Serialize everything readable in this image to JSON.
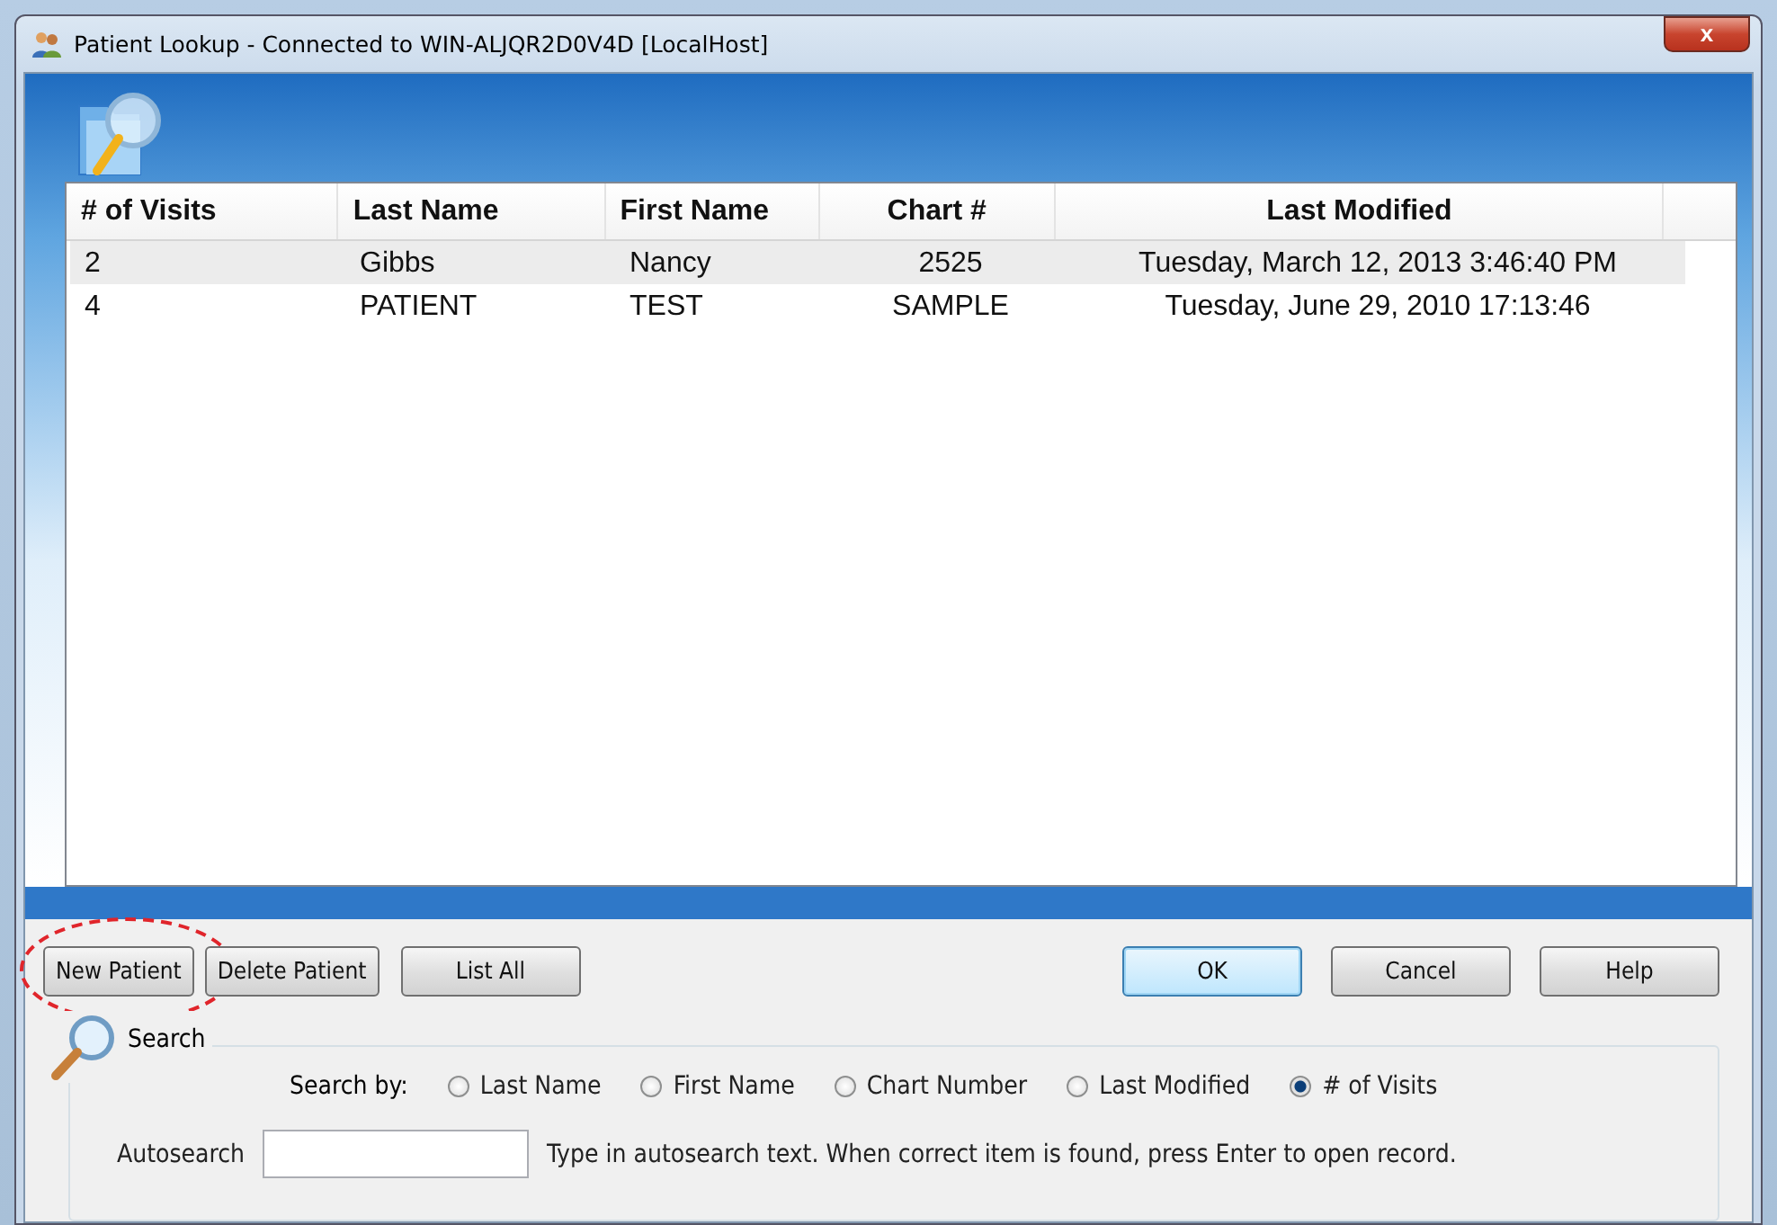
{
  "window": {
    "title": "Patient Lookup - Connected to WIN-ALJQR2D0V4D [LocalHost]",
    "close": "x"
  },
  "table": {
    "columns": [
      "# of Visits",
      "Last Name",
      "First Name",
      "Chart #",
      "Last Modified"
    ],
    "rows": [
      {
        "cells": [
          "2",
          "Gibbs",
          "Nancy",
          "2525",
          "Tuesday, March 12, 2013 3:46:40 PM"
        ],
        "selected": true
      },
      {
        "cells": [
          "4",
          "PATIENT",
          "TEST",
          "SAMPLE",
          "Tuesday, June 29, 2010 17:13:46"
        ],
        "selected": false
      }
    ]
  },
  "buttons_left": [
    {
      "label": "New Patient",
      "highlighted": true
    },
    {
      "label": "Delete Patient",
      "highlighted": false
    },
    {
      "label": "List All",
      "highlighted": false
    }
  ],
  "buttons_right": [
    {
      "label": "OK",
      "default": true
    },
    {
      "label": "Cancel",
      "default": false
    },
    {
      "label": "Help",
      "default": false
    }
  ],
  "search": {
    "title": "Search",
    "search_by_label": "Search by:",
    "options": [
      {
        "label": "Last Name",
        "selected": false
      },
      {
        "label": "First Name",
        "selected": false
      },
      {
        "label": "Chart Number",
        "selected": false
      },
      {
        "label": "Last Modified",
        "selected": false
      },
      {
        "label": "# of Visits",
        "selected": true
      }
    ],
    "autosearch_label": "Autosearch",
    "hint": "Type in autosearch text. When correct item is found, press Enter to open record."
  }
}
